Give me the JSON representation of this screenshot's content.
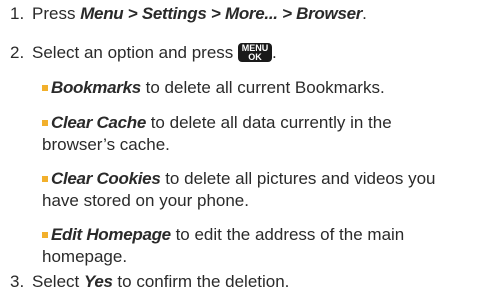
{
  "steps": [
    {
      "num": "1.",
      "pre": "Press ",
      "path": "Menu > Settings > More... > Browser",
      "post": "."
    },
    {
      "num": "2.",
      "pre": "Select an option and press ",
      "key": {
        "top": "MENU",
        "bottom": "OK",
        "icon": "menu-ok-key-icon"
      },
      "post": "."
    },
    {
      "num": "3.",
      "pre": "Select ",
      "em": "Yes",
      "post": " to confirm the deletion."
    }
  ],
  "options": [
    {
      "term": "Bookmarks",
      "line1": " to delete all current Bookmarks.",
      "line2": ""
    },
    {
      "term": "Clear Cache",
      "line1": " to delete all data currently in the",
      "line2": "browser’s cache."
    },
    {
      "term": "Clear Cookies",
      "line1": " to delete all pictures and videos you",
      "line2": "have stored on your phone."
    },
    {
      "term": "Edit Homepage",
      "line1": " to edit the address of the main",
      "line2": "homepage."
    }
  ],
  "colors": {
    "text": "#2a2a2a",
    "bullet": "#f2b02c",
    "key_bg": "#1a1a1a"
  }
}
